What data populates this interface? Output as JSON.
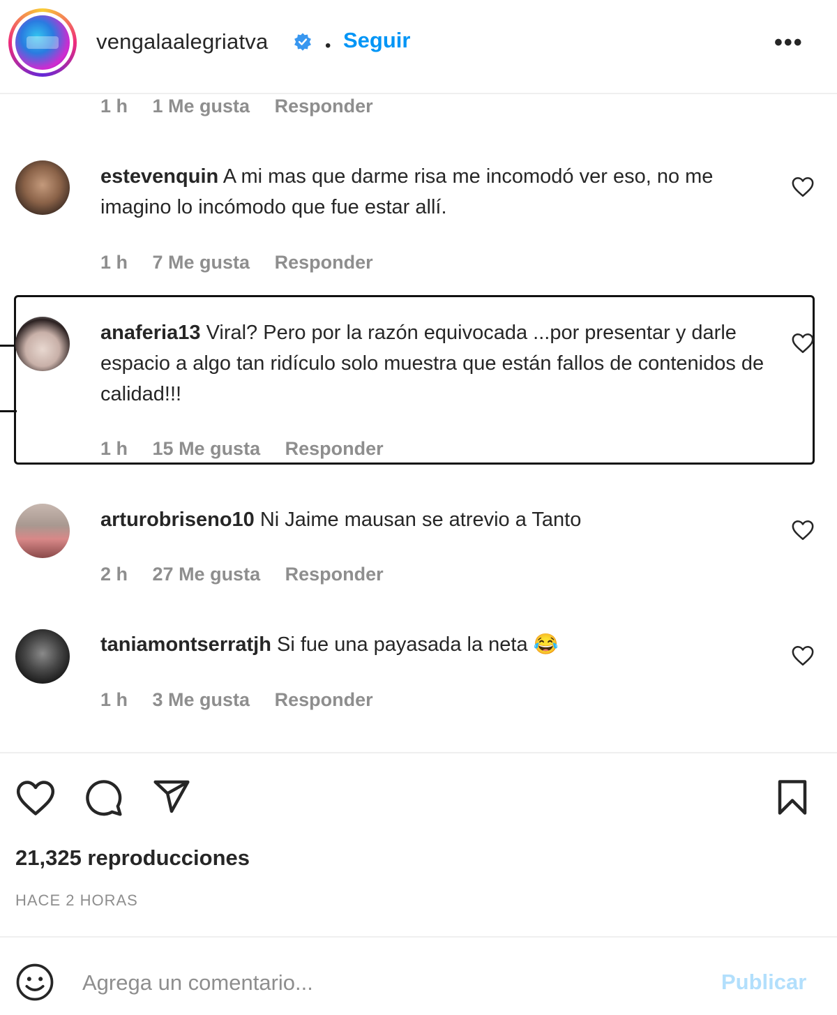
{
  "header": {
    "username": "vengalaalegriatva",
    "separator": "•",
    "follow_label": "Seguir",
    "more_label": "•••"
  },
  "comments": [
    {
      "meta": {
        "time": "1 h",
        "likes": "1 Me gusta",
        "reply": "Responder"
      }
    },
    {
      "user": "estevenquin",
      "text": "A mi mas que darme risa me incomodó ver eso, no me imagino lo incómodo que fue estar allí.",
      "meta": {
        "time": "1 h",
        "likes": "7 Me gusta",
        "reply": "Responder"
      }
    },
    {
      "user": "anaferia13",
      "text": "Viral? Pero por la razón equivocada ...por presentar y darle espacio a algo tan ridículo solo muestra que están fallos de contenidos de calidad!!!",
      "meta": {
        "time": "1 h",
        "likes": "15 Me gusta",
        "reply": "Responder"
      }
    },
    {
      "user": "arturobriseno10",
      "text": "Ni Jaime mausan se atrevio a Tanto",
      "meta": {
        "time": "2 h",
        "likes": "27 Me gusta",
        "reply": "Responder"
      }
    },
    {
      "user": "taniamontserratjh",
      "text": "Si fue una payasada la neta 😂",
      "meta": {
        "time": "1 h",
        "likes": "3 Me gusta",
        "reply": "Responder"
      }
    }
  ],
  "stats": {
    "views": "21,325 reproducciones",
    "posted": "HACE 2 HORAS"
  },
  "composer": {
    "placeholder": "Agrega un comentario...",
    "publish_label": "Publicar"
  },
  "icons": {
    "verified": "verified-badge-icon",
    "like": "heart-icon",
    "comment": "comment-icon",
    "share": "send-icon",
    "save": "bookmark-icon",
    "emoji": "emoji-icon"
  },
  "colors": {
    "accent": "#0095f6",
    "publish_disabled": "#b2dffc",
    "meta_text": "#8e8e8e",
    "text": "#262626"
  }
}
